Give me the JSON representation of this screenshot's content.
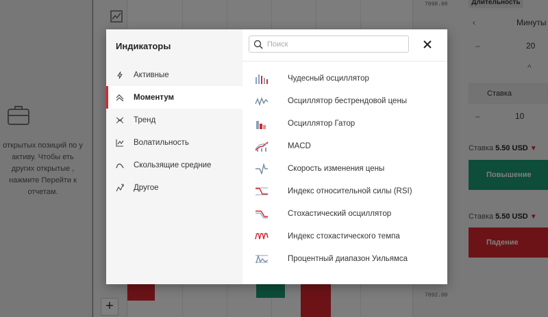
{
  "background": {
    "empty_positions_text": "открытых позиций по у активу. Чтобы еть других открытые , нажмите Перейти к отчетам.",
    "price_top": "7098.00",
    "price_bottom": "7092.00",
    "duration_tab": "Длительность",
    "time_unit": "Минуты",
    "time_value": "20",
    "stake_tab": "Ставка",
    "stake_value": "10",
    "stake_up_label": "Ставка",
    "stake_up_amount": "5.50 USD",
    "stake_down_label": "Ставка",
    "stake_down_amount": "5.50 USD",
    "up_button": "Повышение",
    "down_button": "Падение",
    "colors": {
      "up": "#1a9a73",
      "down": "#d9262f"
    }
  },
  "modal": {
    "title": "Индикаторы",
    "search_placeholder": "Поиск",
    "categories": [
      {
        "label": "Активные",
        "icon": "lightning-icon",
        "active": false
      },
      {
        "label": "Моментум",
        "icon": "momentum-icon",
        "active": true
      },
      {
        "label": "Тренд",
        "icon": "trend-icon",
        "active": false
      },
      {
        "label": "Волатильность",
        "icon": "volatility-icon",
        "active": false
      },
      {
        "label": "Скользящие средние",
        "icon": "moving-average-icon",
        "active": false
      },
      {
        "label": "Другое",
        "icon": "other-icon",
        "active": false
      }
    ],
    "indicators": [
      {
        "label": "Чудесный осциллятор",
        "icon": "awesome-oscillator-icon"
      },
      {
        "label": "Осциллятор бестрендовой цены",
        "icon": "detrended-price-icon"
      },
      {
        "label": "Осциллятор Гатор",
        "icon": "gator-oscillator-icon"
      },
      {
        "label": "MACD",
        "icon": "macd-icon"
      },
      {
        "label": "Скорость изменения цены",
        "icon": "rate-of-change-icon"
      },
      {
        "label": "Индекс относительной силы (RSI)",
        "icon": "rsi-icon"
      },
      {
        "label": "Стохастический осциллятор",
        "icon": "stochastic-oscillator-icon"
      },
      {
        "label": "Индекс стохастического темпа",
        "icon": "stochastic-momentum-icon"
      },
      {
        "label": "Процентный диапазон Уильямса",
        "icon": "williams-percent-range-icon"
      }
    ],
    "accent_color": "#d9262f"
  }
}
